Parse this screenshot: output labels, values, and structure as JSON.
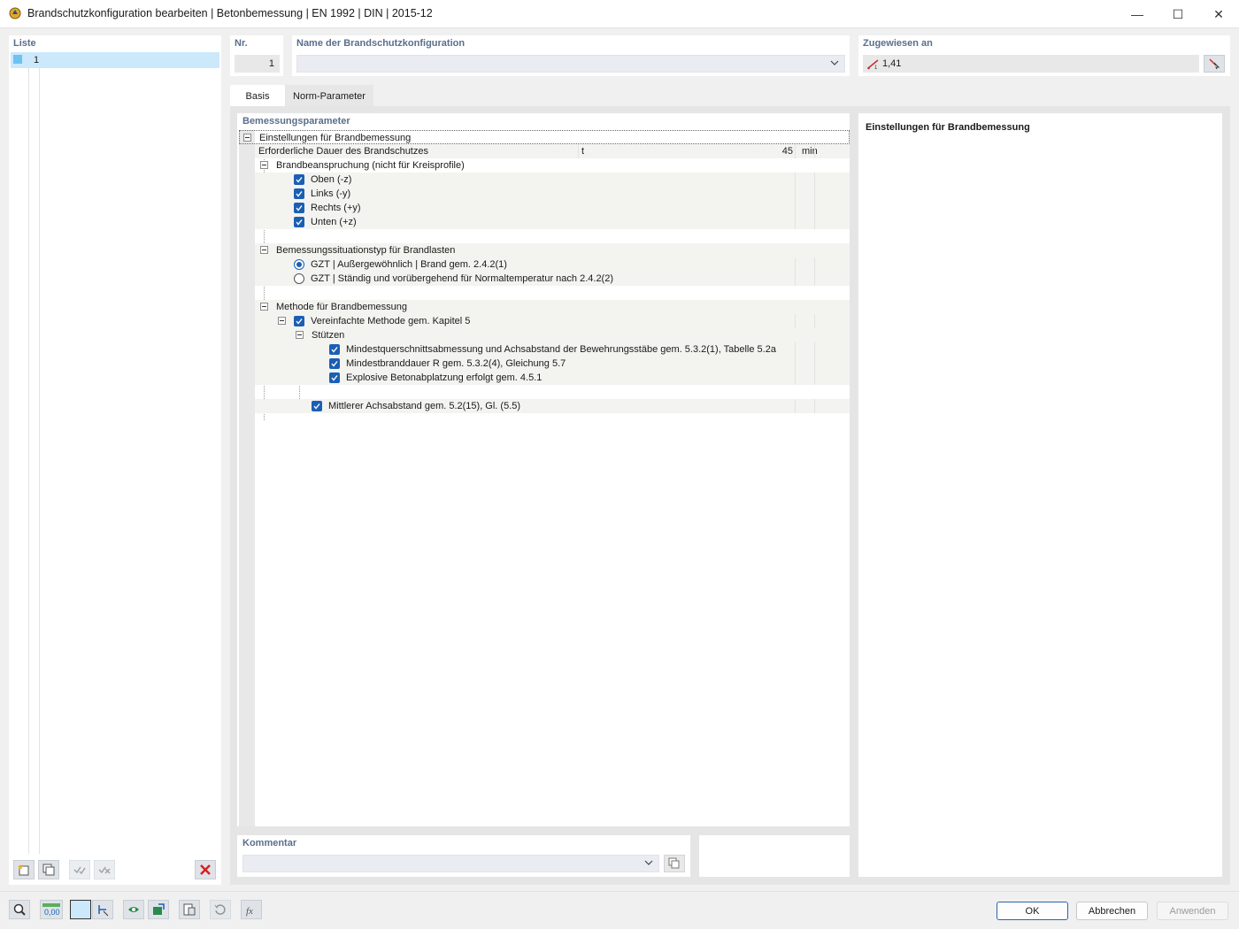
{
  "window": {
    "title": "Brandschutzkonfiguration bearbeiten | Betonbemessung | EN 1992 | DIN | 2015-12",
    "minimize": "—",
    "maximize": "☐",
    "close": "✕"
  },
  "list": {
    "label": "Liste",
    "items": [
      {
        "number": "1",
        "color": "#6ec2f0"
      }
    ]
  },
  "nr": {
    "label": "Nr.",
    "value": "1"
  },
  "name": {
    "label": "Name der Brandschutzkonfiguration",
    "value": ""
  },
  "assigned": {
    "label": "Zugewiesen an",
    "value": "1,41"
  },
  "tabs": [
    {
      "label": "Basis",
      "active": true
    },
    {
      "label": "Norm-Parameter",
      "active": false
    }
  ],
  "params": {
    "label": "Bemessungsparameter",
    "root": "Einstellungen für Brandbemessung",
    "duration": {
      "label": "Erforderliche Dauer des Brandschutzes",
      "symbol": "t",
      "value": "45",
      "unit": "min"
    },
    "exposure": {
      "label": "Brandbeanspruchung (nicht für Kreisprofile)",
      "items": [
        {
          "label": "Oben (-z)",
          "checked": true
        },
        {
          "label": "Links (-y)",
          "checked": true
        },
        {
          "label": "Rechts (+y)",
          "checked": true
        },
        {
          "label": "Unten (+z)",
          "checked": true
        }
      ]
    },
    "situation": {
      "label": "Bemessungssituationstyp für Brandlasten",
      "options": [
        {
          "label": "GZT | Außergewöhnlich | Brand gem. 2.4.2(1)",
          "selected": true
        },
        {
          "label": "GZT | Ständig und vorübergehend für Normaltemperatur nach 2.4.2(2)",
          "selected": false
        }
      ]
    },
    "method": {
      "label": "Methode für Brandbemessung",
      "simplified": {
        "label": "Vereinfachte Methode gem. Kapitel 5",
        "checked": true
      },
      "columns": {
        "label": "Stützen",
        "items": [
          {
            "label": "Mindestquerschnittsabmessung und Achsabstand der Bewehrungsstäbe gem. 5.3.2(1), Tabelle 5.2a",
            "checked": true
          },
          {
            "label": "Mindestbranddauer R gem. 5.3.2(4), Gleichung 5.7",
            "checked": true
          },
          {
            "label": "Explosive Betonabplatzung erfolgt gem. 4.5.1",
            "checked": true
          }
        ]
      },
      "mean_axis": {
        "label": "Mittlerer Achsabstand gem. 5.2(15), Gl. (5.5)",
        "checked": true
      }
    }
  },
  "description": {
    "title": "Einstellungen für Brandbemessung"
  },
  "comment": {
    "label": "Kommentar",
    "value": ""
  },
  "buttons": {
    "ok": "OK",
    "cancel": "Abbrechen",
    "apply": "Anwenden"
  },
  "bottom_tool_value": "0,00",
  "colors": {
    "accent": "#1a5fb4",
    "label": "#5a6e8c",
    "selection": "#cce8fb",
    "delete": "#d92020"
  }
}
